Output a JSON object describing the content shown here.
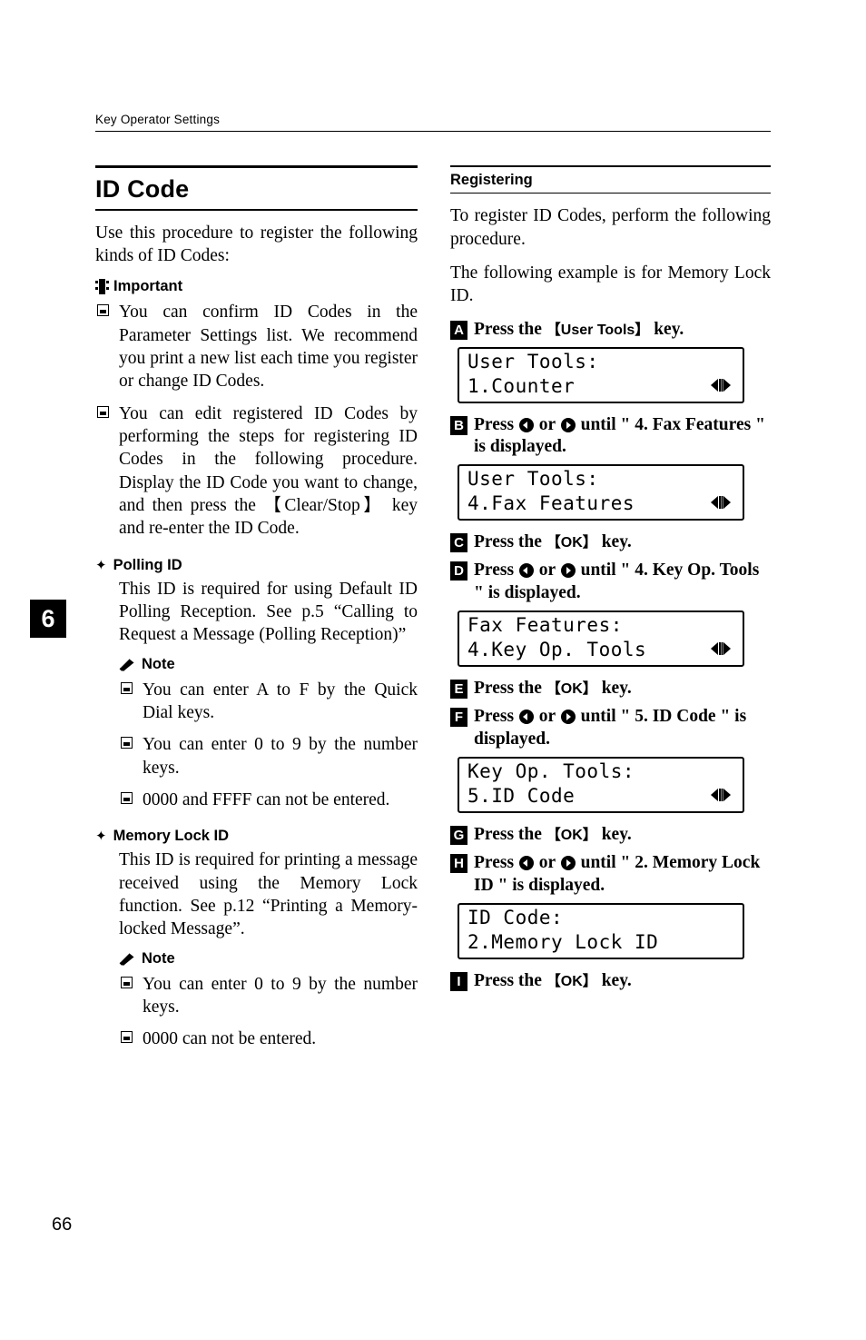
{
  "header": {
    "running_head": "Key Operator Settings"
  },
  "chapter_tab": "6",
  "page_number": "66",
  "left": {
    "title": "ID Code",
    "intro": "Use this procedure to register the following kinds of ID Codes:",
    "important_label": "Important",
    "important_items": [
      "You can confirm ID Codes in the Parameter Settings list. We recommend you print a new list each time you register or change ID Codes.",
      "You can edit registered ID Codes by performing the steps for registering ID Codes in the following procedure. Display the ID Code you want to change, and then press the 【Clear/Stop】 key and re-enter the ID Code."
    ],
    "polling": {
      "heading": "Polling ID",
      "body": "This ID is required for using Default ID Polling Reception. See p.5 “Calling to Request a Message (Polling Reception)”",
      "note_label": "Note",
      "notes": [
        "You can enter A to F by the Quick Dial keys.",
        "You can enter 0 to 9 by the number keys.",
        "0000 and FFFF can not be entered."
      ]
    },
    "memory_lock": {
      "heading": "Memory Lock ID",
      "body": "This ID is required for printing a message received using the Memory Lock function. See  p.12 “Printing a Memory-locked Message”.",
      "note_label": "Note",
      "notes": [
        "You can enter 0 to 9 by the number keys.",
        "0000 can not be entered."
      ]
    }
  },
  "right": {
    "section_title": "Registering",
    "intro1": "To register ID Codes, perform the following procedure.",
    "intro2": "The following example is for Memory Lock ID.",
    "steps": [
      {
        "num": "A",
        "text_parts": [
          "Press the ",
          "【User Tools】",
          " key."
        ],
        "lcd": {
          "line1": "User Tools:",
          "line2": "1.Counter",
          "indicator": true
        }
      },
      {
        "num": "B",
        "text_parts": [
          "Press ",
          "◀",
          " or ",
          "▶",
          " until \" 4. Fax Features \" is displayed."
        ],
        "lcd": {
          "line1": "User Tools:",
          "line2": "4.Fax Features",
          "indicator": true
        }
      },
      {
        "num": "C",
        "text_parts": [
          "Press the ",
          "【OK】",
          " key."
        ],
        "lcd": null
      },
      {
        "num": "D",
        "text_parts": [
          "Press ",
          "◀",
          " or ",
          "▶",
          " until \" 4. Key Op. Tools \" is displayed."
        ],
        "lcd": {
          "line1": "Fax Features:",
          "line2": "4.Key Op. Tools",
          "indicator": true
        }
      },
      {
        "num": "E",
        "text_parts": [
          "Press the ",
          "【OK】",
          " key."
        ],
        "lcd": null
      },
      {
        "num": "F",
        "text_parts": [
          "Press ",
          "◀",
          " or ",
          "▶",
          " until \" 5. ID Code \" is displayed."
        ],
        "lcd": {
          "line1": "Key Op. Tools:",
          "line2": "5.ID Code",
          "indicator": true
        }
      },
      {
        "num": "G",
        "text_parts": [
          "Press the ",
          "【OK】",
          " key."
        ],
        "lcd": null
      },
      {
        "num": "H",
        "text_parts": [
          "Press ",
          "◀",
          " or ",
          "▶",
          " until \" 2. Memory Lock ID \" is displayed."
        ],
        "lcd": {
          "line1": "ID Code:",
          "line2": "2.Memory Lock ID",
          "indicator": false
        }
      },
      {
        "num": "I",
        "text_parts": [
          "Press the ",
          "【OK】",
          " key."
        ],
        "lcd": null
      }
    ],
    "step_labels": {
      "press_the": "Press the ",
      "key_suffix": " key.",
      "press": "Press ",
      "or": " or ",
      "user_tools_key": "【User Tools】",
      "ok_key": "【OK】",
      "until_fax": " until \" 4. Fax Features \" is displayed.",
      "until_keyop": " until \" 4. Key Op. Tools \" is displayed.",
      "until_idcode": " until \" 5. ID Code \" is displayed.",
      "until_memlock": " until \" 2. Memory Lock ID \" is displayed."
    }
  }
}
